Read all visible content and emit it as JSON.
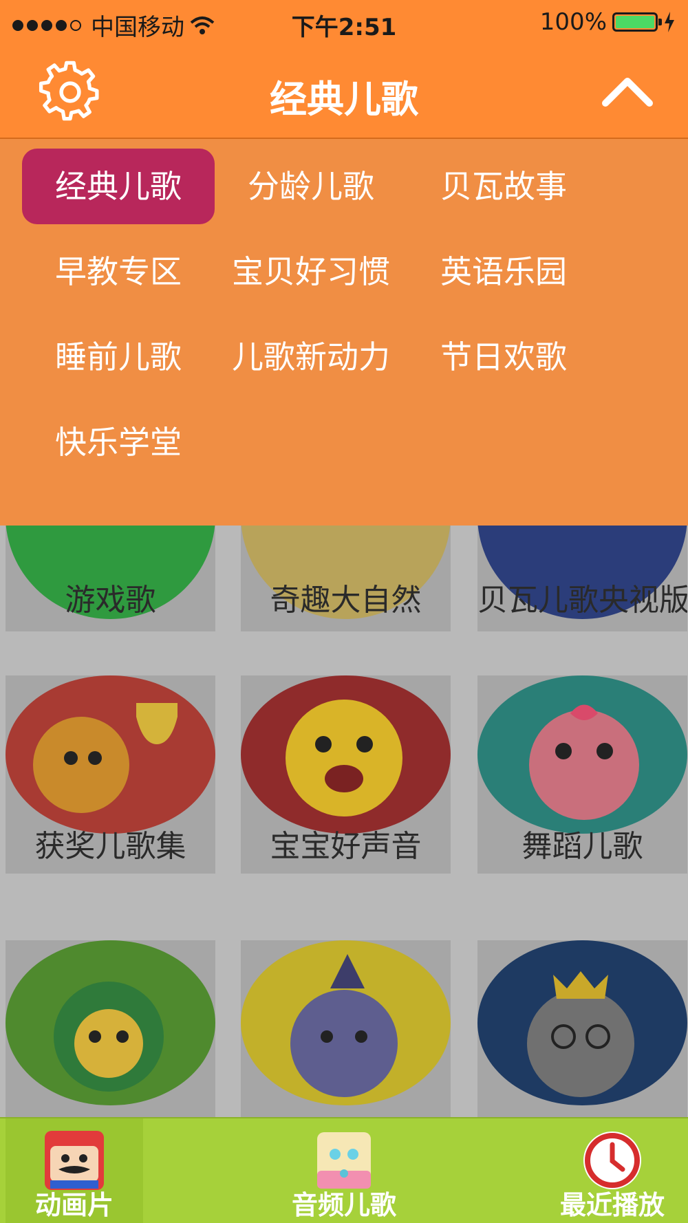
{
  "status": {
    "carrier": "中国移动",
    "time": "下午2:51",
    "battery": "100%"
  },
  "navbar": {
    "title": "经典儿歌"
  },
  "categories": [
    "经典儿歌",
    "分龄儿歌",
    "贝瓦故事",
    "早教专区",
    "宝贝好习惯",
    "英语乐园",
    "睡前儿歌",
    "儿歌新动力",
    "节日欢歌",
    "快乐学堂"
  ],
  "grid": {
    "row1": [
      "游戏歌",
      "奇趣大自然",
      "贝瓦儿歌央视版"
    ],
    "row2": [
      "获奖儿歌集",
      "宝宝好声音",
      "舞蹈儿歌"
    ]
  },
  "tabs": [
    "动画片",
    "音频儿歌",
    "最近播放"
  ],
  "colors": {
    "header": "#ff8a33",
    "dropdown": "#f08e44",
    "active_chip": "#b8275b",
    "tabbar": "#a6d13a"
  }
}
